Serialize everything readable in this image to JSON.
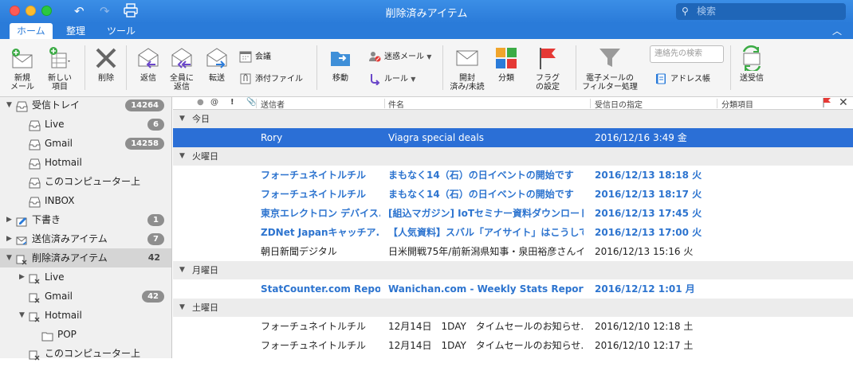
{
  "window": {
    "title": "削除済みアイテム",
    "search_placeholder": "検索"
  },
  "ribbon_tabs": [
    "ホーム",
    "整理",
    "ツール"
  ],
  "ribbon": {
    "new_mail": [
      "新規",
      "メール"
    ],
    "new_item": [
      "新しい",
      "項目"
    ],
    "delete": "削除",
    "reply": "返信",
    "reply_all": [
      "全員に",
      "返信"
    ],
    "forward": "転送",
    "meeting": "会議",
    "attachment": "添付ファイル",
    "move": "移動",
    "junk": "迷惑メール",
    "rules": "ルール",
    "read_unread": [
      "開封",
      "済み/未読"
    ],
    "categorize": "分類",
    "follow_up": [
      "フラグ",
      "の設定"
    ],
    "filter": [
      "電子メールの",
      "フィルター処理"
    ],
    "contact_search_placeholder": "連絡先の検索",
    "address_book": "アドレス帳",
    "send_receive": "送受信"
  },
  "folders": [
    {
      "label": "受信トレイ",
      "badge": "14264",
      "level": 0,
      "arrow": "▼",
      "icon": "inbox-icon"
    },
    {
      "label": "Live",
      "badge": "6",
      "level": 1,
      "arrow": "",
      "icon": "inbox-icon"
    },
    {
      "label": "Gmail",
      "badge": "14258",
      "level": 1,
      "arrow": "",
      "icon": "inbox-icon"
    },
    {
      "label": "Hotmail",
      "badge": "",
      "level": 1,
      "arrow": "",
      "icon": "inbox-icon"
    },
    {
      "label": "このコンピューター上",
      "badge": "",
      "level": 1,
      "arrow": "",
      "icon": "inbox-icon"
    },
    {
      "label": "INBOX",
      "badge": "",
      "level": 1,
      "arrow": "",
      "icon": "inbox-icon"
    },
    {
      "label": "下書き",
      "badge": "1",
      "level": 0,
      "arrow": "▶",
      "icon": "drafts-icon"
    },
    {
      "label": "送信済みアイテム",
      "badge": "7",
      "level": 0,
      "arrow": "▶",
      "icon": "sent-icon"
    },
    {
      "label": "削除済みアイテム",
      "count": "42",
      "level": 0,
      "arrow": "▼",
      "icon": "trash-icon",
      "selected": true
    },
    {
      "label": "Live",
      "badge": "",
      "level": 1,
      "arrow": "▶",
      "icon": "trash-icon"
    },
    {
      "label": "Gmail",
      "badge": "42",
      "level": 1,
      "arrow": "",
      "icon": "trash-icon"
    },
    {
      "label": "Hotmail",
      "badge": "",
      "level": 1,
      "arrow": "▼",
      "icon": "trash-icon"
    },
    {
      "label": "POP",
      "badge": "",
      "level": 2,
      "arrow": "",
      "icon": "folder-icon"
    },
    {
      "label": "このコンピューター上",
      "badge": "",
      "level": 1,
      "arrow": "",
      "icon": "trash-icon"
    }
  ],
  "columns": {
    "from": "送信者",
    "subject": "件名",
    "received": "受信日の指定",
    "category": "分類項目"
  },
  "groups": [
    {
      "label": "今日",
      "messages": [
        {
          "from": "Rory",
          "subject": "Viagra special deals",
          "date": "2016/12/16 3:49 金",
          "state": "selected"
        }
      ]
    },
    {
      "label": "火曜日",
      "messages": [
        {
          "from": "フォーチュネイトルチル",
          "subject": "まもなく14（石）の日イベントの開始です　フ...",
          "date": "2016/12/13 18:18 火",
          "state": "unread"
        },
        {
          "from": "フォーチュネイトルチル",
          "subject": "まもなく14（石）の日イベントの開始です　フ...",
          "date": "2016/12/13 18:17 火",
          "state": "unread"
        },
        {
          "from": "東京エレクトロン デバイス...",
          "subject": "[組込マガジン] IoTセミナー資料ダウンロード、...",
          "date": "2016/12/13 17:45 火",
          "state": "unread"
        },
        {
          "from": "ZDNet Japanキャッチア...",
          "subject": "【人気資料】スバル「アイサイト」はこうして誕...",
          "date": "2016/12/13 17:00 火",
          "state": "unread"
        },
        {
          "from": "朝日新聞デジタル",
          "subject": "日米開戦75年/前新潟県知事・泉田裕彦さんイン...",
          "date": "2016/12/13 15:16 火",
          "state": "read"
        }
      ]
    },
    {
      "label": "月曜日",
      "messages": [
        {
          "from": "StatCounter.com Repo...",
          "subject": "Wanichan.com - Weekly Stats Report 5...",
          "date": "2016/12/12 1:01 月",
          "state": "unread"
        }
      ]
    },
    {
      "label": "土曜日",
      "messages": [
        {
          "from": "フォーチュネイトルチル",
          "subject": "12月14日　1DAY　タイムセールのお知らせ...",
          "date": "2016/12/10 12:18 土",
          "state": "read"
        },
        {
          "from": "フォーチュネイトルチル",
          "subject": "12月14日　1DAY　タイムセールのお知らせ...",
          "date": "2016/12/10 12:17 土",
          "state": "read"
        }
      ]
    }
  ],
  "colors": {
    "accent": "#2a7bd9",
    "selected_row": "#2b6fd6",
    "unread_text": "#2d74cf",
    "flag": "#e53935"
  }
}
